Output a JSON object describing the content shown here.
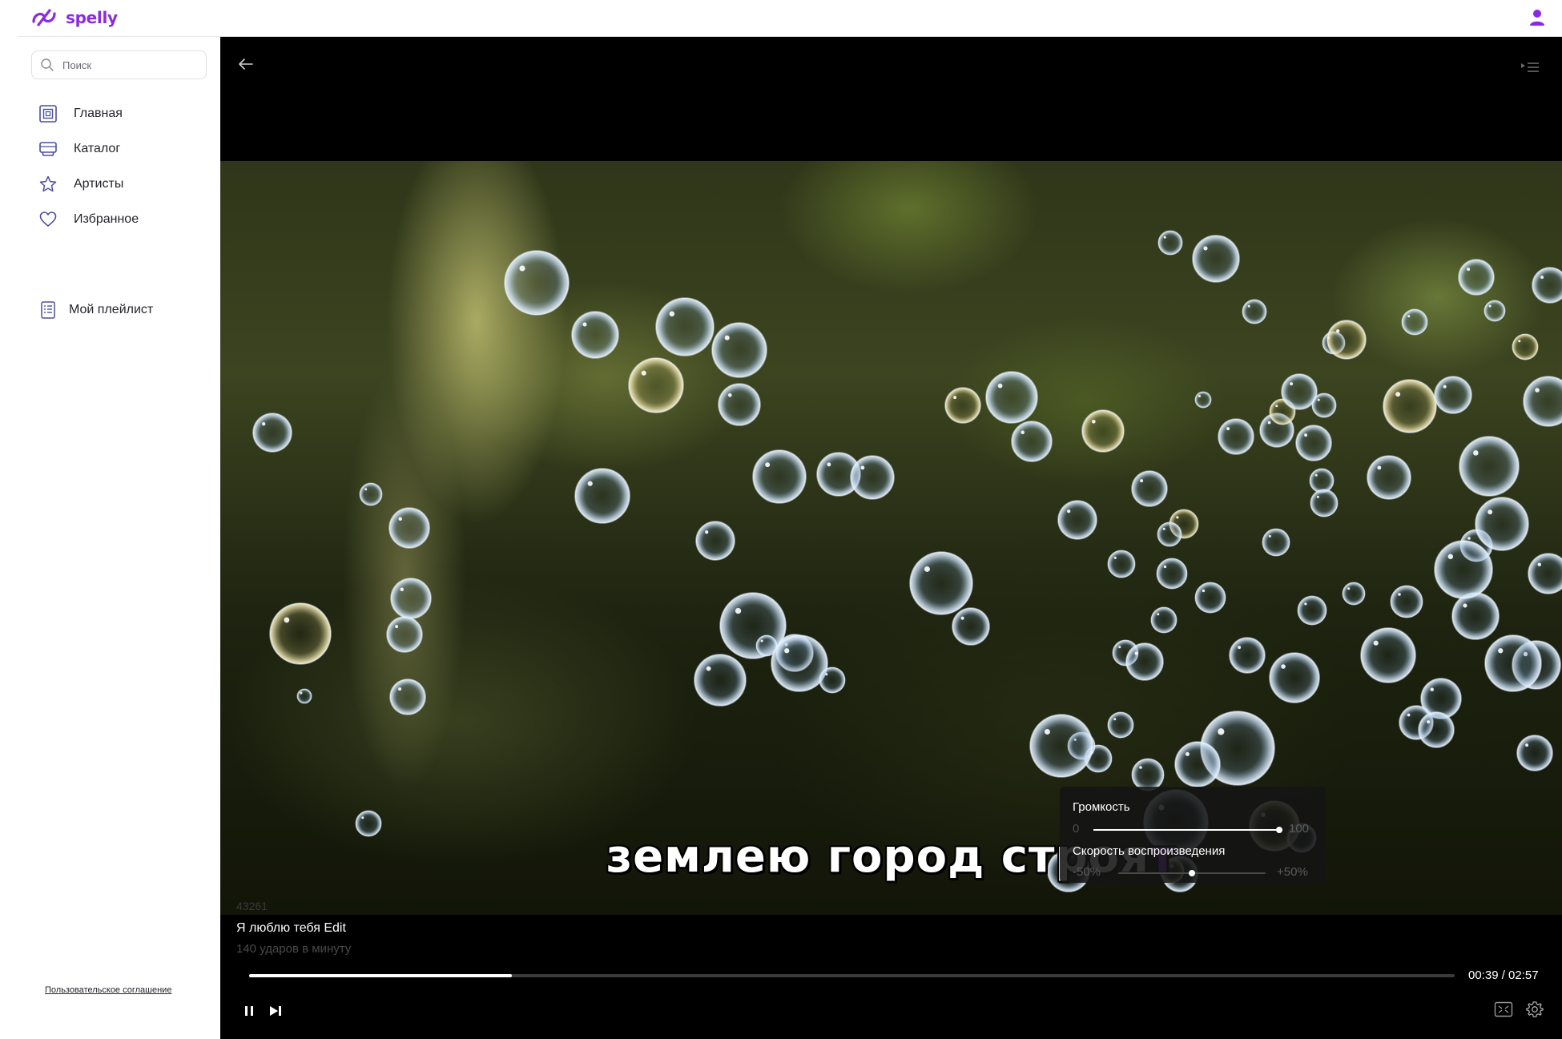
{
  "app": {
    "name": "spelly",
    "accent": "#8a2be2"
  },
  "search": {
    "placeholder": "Поиск",
    "value": ""
  },
  "sidebar": {
    "items": [
      {
        "label": "Главная",
        "icon": "home-icon"
      },
      {
        "label": "Каталог",
        "icon": "catalog-icon"
      },
      {
        "label": "Артисты",
        "icon": "star-icon"
      },
      {
        "label": "Избранное",
        "icon": "heart-icon"
      }
    ],
    "playlist": {
      "label": "Мой плейлист",
      "icon": "playlist-icon"
    },
    "agreement": "Пользовательское соглашение"
  },
  "player": {
    "lyric": {
      "sung": "землею город строя",
      "upcoming": "т"
    },
    "counter": "43261",
    "track_title": "Я люблю тебя Edit",
    "bpm": "140 ударов в минуту",
    "progress": 0.218,
    "time": "00:39 / 02:57",
    "controls": {
      "pause": "pause-icon",
      "next": "skip-next-icon",
      "fullscreen": "fullscreen-icon",
      "settings": "gear-icon"
    }
  },
  "settings": {
    "volume": {
      "label": "Громкость",
      "min": "0",
      "max": "100",
      "value": 1.0
    },
    "speed": {
      "label": "Скорость воспроизведения",
      "min": "-50%",
      "max": "+50%",
      "value": 0.5
    }
  }
}
